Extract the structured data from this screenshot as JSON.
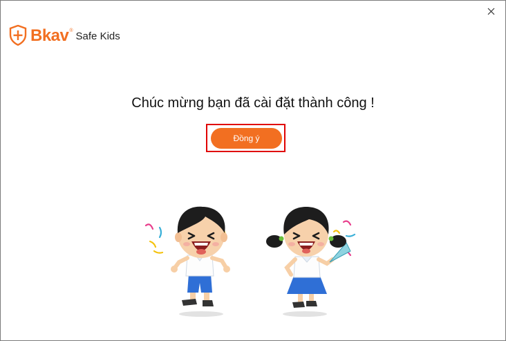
{
  "window": {
    "close_icon": "close-icon"
  },
  "logo": {
    "brand": "Bkav",
    "registered": "®",
    "product": "Safe Kids",
    "shield_icon": "shield-icon",
    "color": "#f26f21"
  },
  "main": {
    "message": "Chúc mừng bạn đã cài đặt thành công !",
    "agree_button": "Đồng ý",
    "accent": "#f26f21",
    "highlight_color": "#e00000"
  },
  "illustration": {
    "subject": "two-celebrating-children-with-confetti"
  }
}
